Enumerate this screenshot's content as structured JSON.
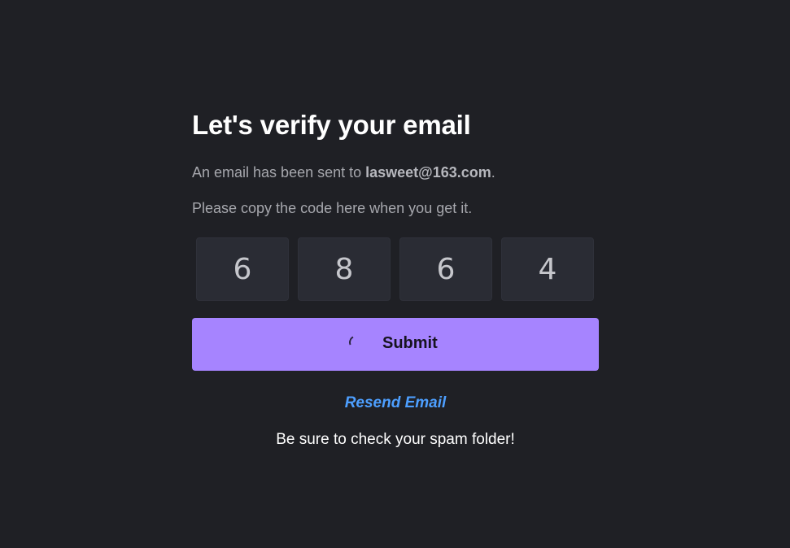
{
  "verify": {
    "title": "Let's verify your email",
    "sent_prefix": "An email has been sent to ",
    "email": "lasweet@163.com",
    "sent_suffix": ".",
    "instructions": "Please copy the code here when you get it.",
    "code_digits": [
      "6",
      "8",
      "6",
      "4"
    ],
    "submit_label": "Submit",
    "submit_loading": true,
    "resend_label": "Resend Email",
    "spam_note": "Be sure to check your spam folder!"
  },
  "colors": {
    "background": "#1f2025",
    "code_box": "#2a2c34",
    "submit_button": "#a684ff",
    "resend_link": "#4d9fff",
    "muted_text": "#a6a7ad"
  },
  "icons": {
    "submit_loading": "spinner-icon"
  }
}
